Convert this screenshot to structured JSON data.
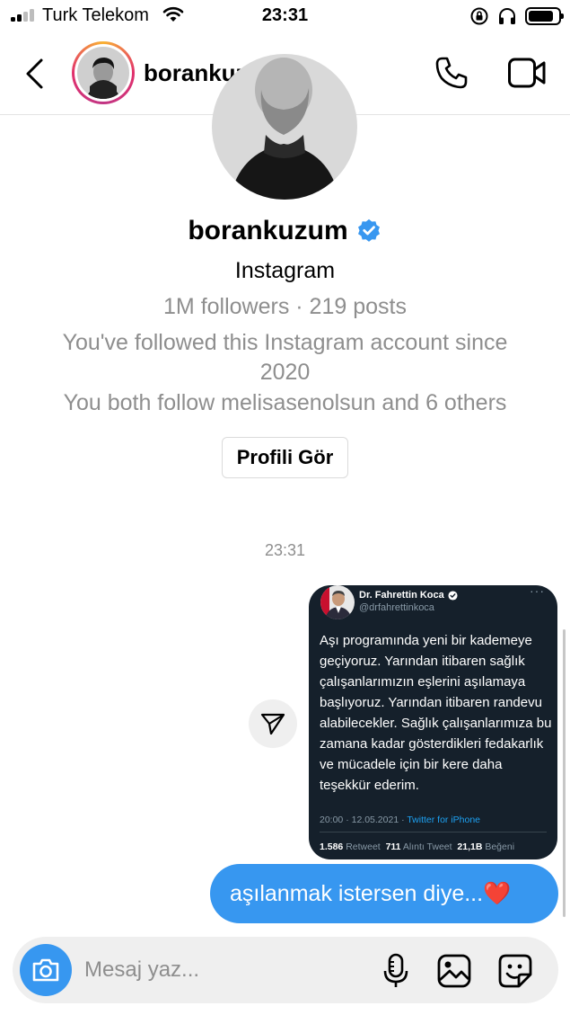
{
  "status_bar": {
    "carrier": "Turk Telekom",
    "time": "23:31",
    "battery_level": 0.85
  },
  "header": {
    "username": "borankuzum",
    "verified": true
  },
  "profile": {
    "username": "borankuzum",
    "subtitle": "Instagram",
    "stats": "1M followers · 219 posts",
    "followed_since": "You've followed this Instagram account since 2020",
    "mutual": "You both follow melisasenolsun and 6 others",
    "view_profile_label": "Profili Gör"
  },
  "conversation": {
    "timestamp": "23:31",
    "shared_tweet": {
      "author_name": "Dr. Fahrettin Koca",
      "author_handle": "@drfahrettinkoca",
      "text": "Aşı programında yeni bir kademeye geçiyoruz. Yarından itibaren sağlık çalışanlarımızın eşlerini aşılamaya başlıyoruz. Yarından itibaren randevu alabilecekler. Sağlık çalışanlarımıza bu zamana kadar gösterdikleri fedakarlık ve mücadele için bir kere daha teşekkür ederim.",
      "time_date": "20:00 · 12.05.2021 ·",
      "source": "Twitter for iPhone",
      "retweets": "1.586",
      "retweets_label": "Retweet",
      "quotes": "711",
      "quotes_label": "Alıntı Tweet",
      "likes": "21,1B",
      "likes_label": "Beğeni"
    },
    "sent_message": "aşılanmak istersen diye...❤️"
  },
  "composer": {
    "placeholder": "Mesaj yaz..."
  },
  "colors": {
    "accent": "#3797f0",
    "verified": "#3897f0",
    "tweet_bg": "#15202b",
    "muted": "#8e8e8e"
  },
  "icons": [
    "back-chevron-icon",
    "phone-icon",
    "video-camera-icon",
    "verified-badge-icon",
    "share-icon",
    "camera-icon",
    "microphone-icon",
    "gallery-icon",
    "sticker-icon"
  ]
}
